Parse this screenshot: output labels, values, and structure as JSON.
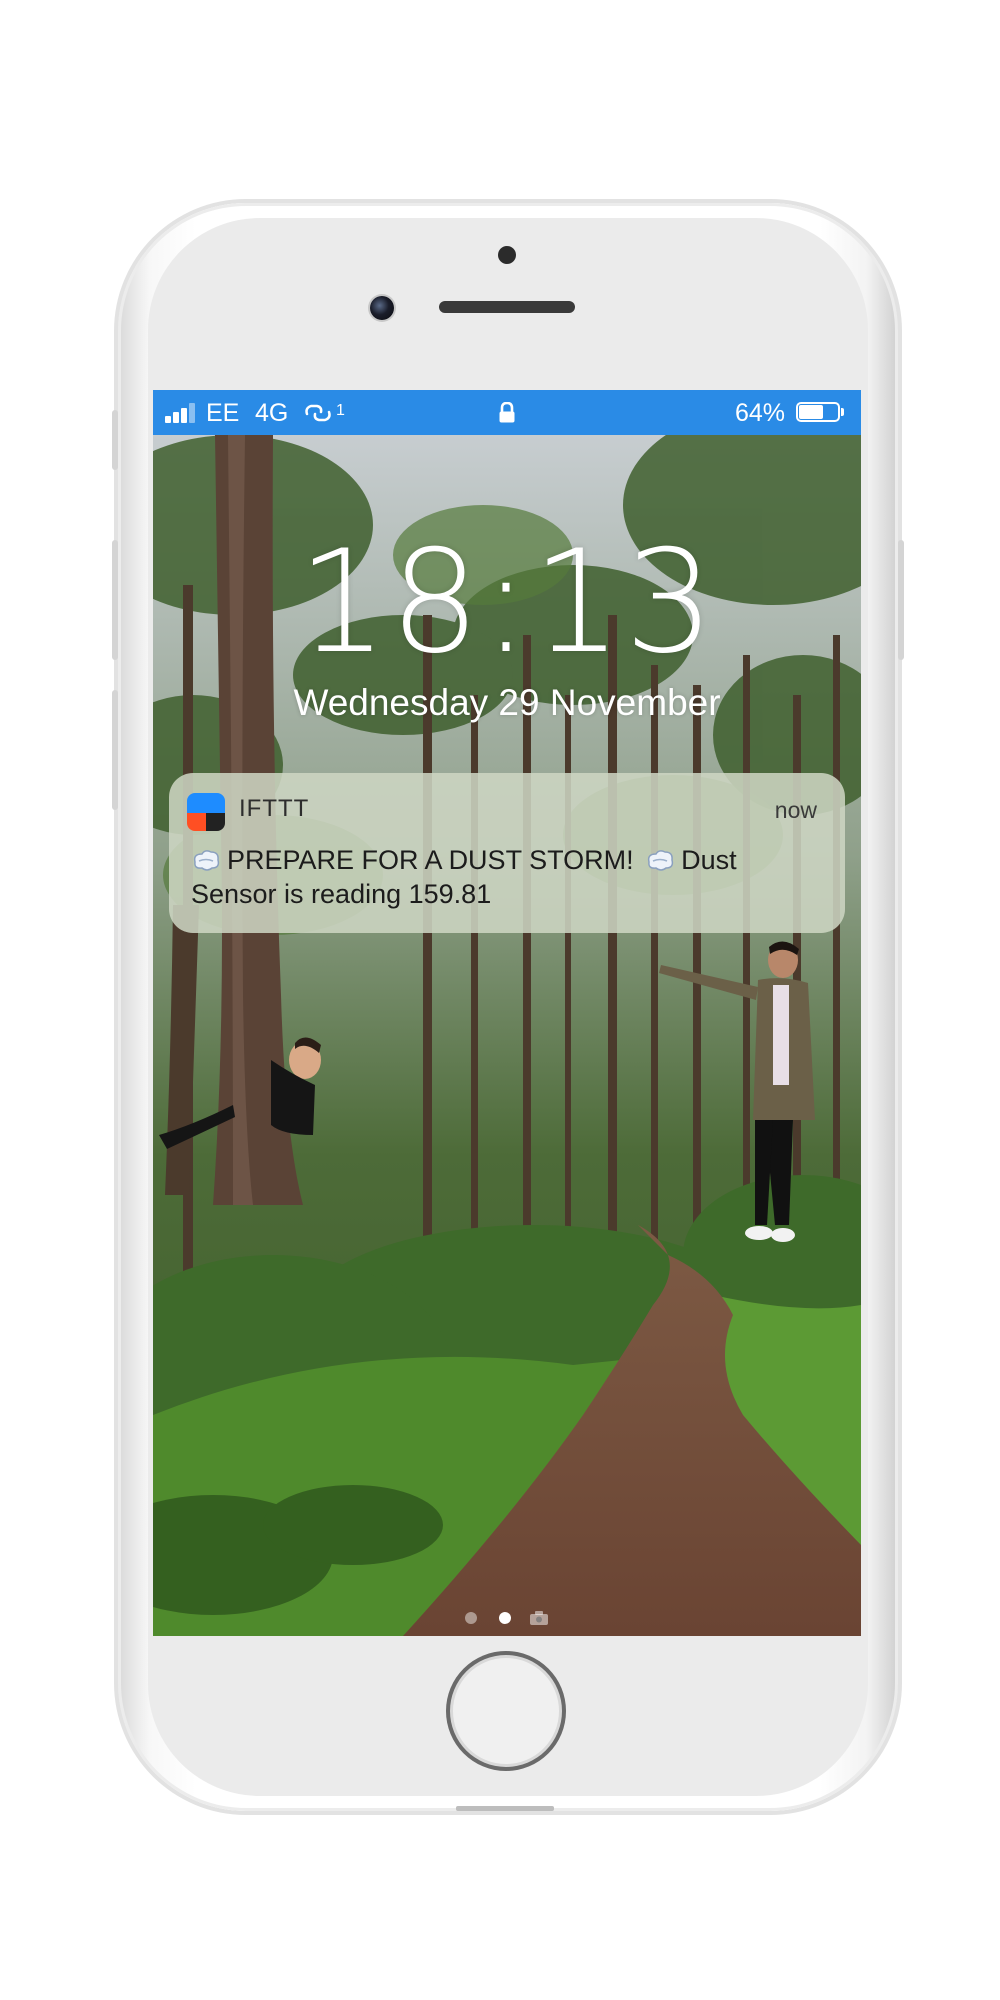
{
  "status_bar": {
    "carrier": "EE",
    "network": "4G",
    "link_badge": "1",
    "battery_percent": "64%",
    "battery_level": 0.64,
    "background_color": "#2a8be6"
  },
  "lockscreen": {
    "time": "18:13",
    "date": "Wednesday 29 November"
  },
  "notification": {
    "app_name": "IFTTT",
    "time": "now",
    "message_part1": "PREPARE FOR A DUST STORM!",
    "message_part2": "Dust Sensor is reading 159.81",
    "icon_colors": {
      "top": "#1e8cff",
      "bottom_left": "#ff4f23",
      "bottom_right": "#222222"
    }
  },
  "page_indicators": {
    "count": 3,
    "active_index": 1,
    "last_is_camera": true
  },
  "icons": [
    "signal-icon",
    "link-icon",
    "lock-icon",
    "battery-icon",
    "wind-icon",
    "camera-icon"
  ]
}
